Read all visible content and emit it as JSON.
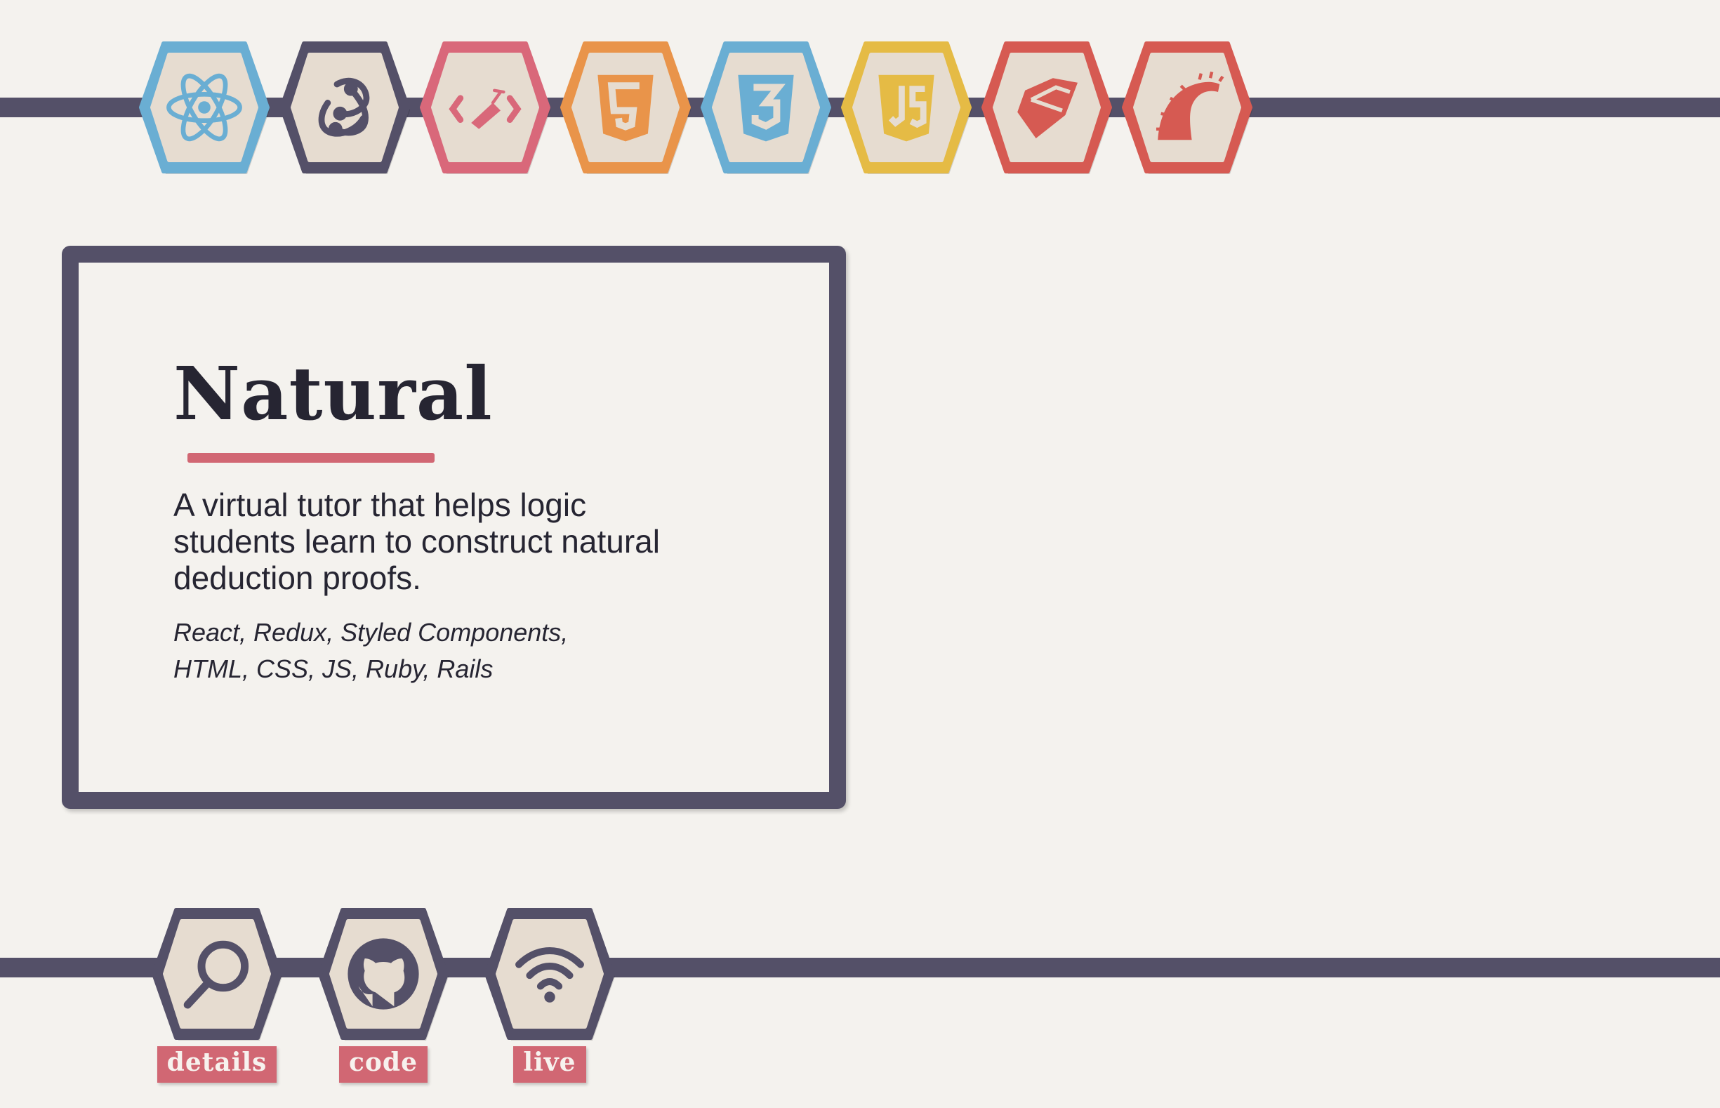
{
  "tech_icons": [
    {
      "name": "react-icon",
      "color": "#6aaed3"
    },
    {
      "name": "redux-icon",
      "color": "#545068"
    },
    {
      "name": "styled-components-icon",
      "color": "#d9687a"
    },
    {
      "name": "html5-icon",
      "color": "#e9944a"
    },
    {
      "name": "css3-icon",
      "color": "#6aaed3"
    },
    {
      "name": "js-icon",
      "color": "#e5bb45"
    },
    {
      "name": "ruby-icon",
      "color": "#d65a52"
    },
    {
      "name": "rails-icon",
      "color": "#d65a52"
    }
  ],
  "project": {
    "title": "Natural",
    "description": "A virtual tutor that helps logic students learn to construct natural deduction proofs.",
    "stack": "React, Redux, Styled Components, HTML, CSS, JS, Ruby, Rails"
  },
  "links": [
    {
      "label": "details",
      "icon": "magnifier-icon"
    },
    {
      "label": "code",
      "icon": "github-icon"
    },
    {
      "label": "live",
      "icon": "wifi-icon"
    }
  ],
  "colors": {
    "background": "#f4f2ee",
    "rail": "#545068",
    "accent": "#d16773",
    "hex_fill": "#e6dcd0",
    "text": "#262532"
  }
}
